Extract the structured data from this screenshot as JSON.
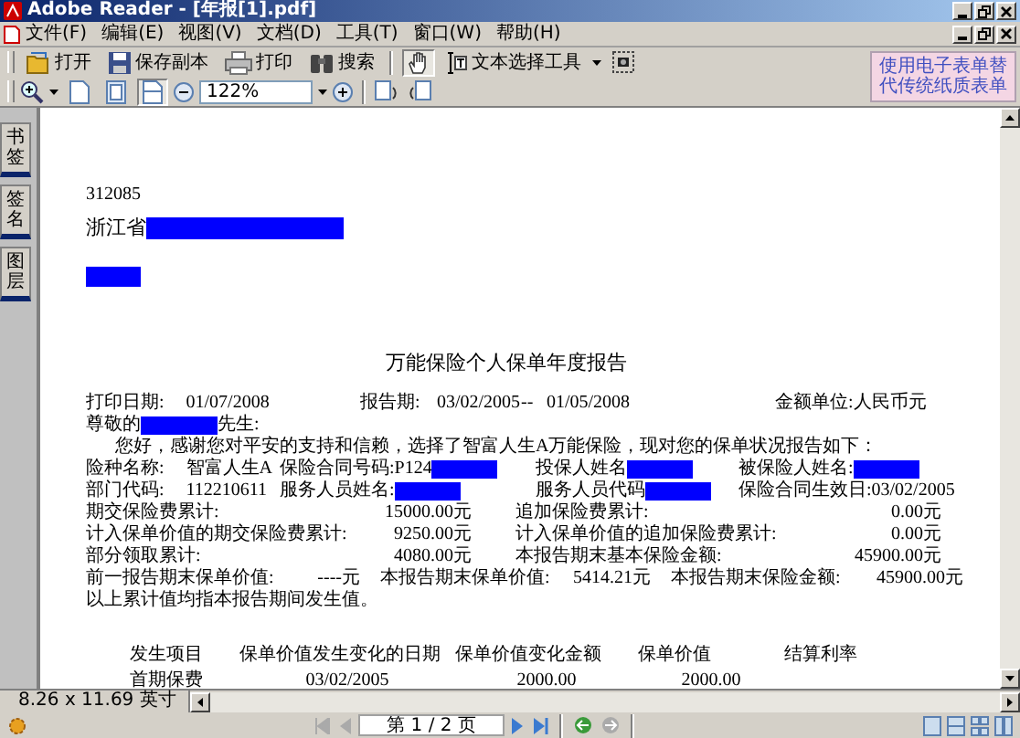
{
  "window": {
    "title": "Adobe Reader - [年报[1].pdf]"
  },
  "menu": [
    {
      "label": "文件(F)"
    },
    {
      "label": "编辑(E)"
    },
    {
      "label": "视图(V)"
    },
    {
      "label": "文档(D)"
    },
    {
      "label": "工具(T)"
    },
    {
      "label": "窗口(W)"
    },
    {
      "label": "帮助(H)"
    }
  ],
  "toolbar_file": [
    {
      "label": "打开"
    },
    {
      "label": "保存副本"
    },
    {
      "label": "打印"
    },
    {
      "label": "搜索"
    }
  ],
  "tools": [
    {
      "kind": "hand",
      "selected": true
    },
    {
      "kind": "text_select",
      "label": "文本选择工具",
      "selected": false
    },
    {
      "kind": "snapshot",
      "selected": false
    }
  ],
  "view_buttons": [
    {
      "selected": false
    },
    {
      "selected": false
    },
    {
      "selected": true
    }
  ],
  "zoom": {
    "value": "122%"
  },
  "ad_banner": {
    "lines": [
      "使用电子表单替",
      "代传统纸质表单"
    ]
  },
  "nav_tabs": [
    {
      "label": "书签"
    },
    {
      "label": "签名"
    },
    {
      "label": "图层"
    }
  ],
  "document": {
    "lines": [
      {
        "kind": "postcode",
        "segments": [
          {
            "kind": "text",
            "text": "312085"
          }
        ]
      },
      {
        "kind": "address",
        "segments": [
          {
            "kind": "text",
            "text": "浙江省"
          },
          {
            "kind": "redaction"
          }
        ]
      },
      {
        "kind": "recipient",
        "segments": [
          {
            "kind": "redaction"
          }
        ]
      },
      {
        "kind": "title",
        "segments": [
          {
            "kind": "text",
            "text": "万能保险个人保单年度报告"
          }
        ]
      },
      {
        "kind": "header",
        "cells": [
          [
            {
              "kind": "text",
              "text": "打印日期:"
            },
            {
              "kind": "text",
              "text": "01/07/2008"
            }
          ],
          [
            {
              "kind": "text",
              "text": "报告期:"
            }
          ],
          [
            {
              "kind": "text",
              "text": "03/02/2005"
            }
          ],
          [
            {
              "kind": "text",
              "text": "--"
            }
          ],
          [
            {
              "kind": "text",
              "text": "01/05/2008"
            }
          ],
          [
            {
              "kind": "text",
              "text": "金额单位:人民币元"
            }
          ]
        ]
      },
      {
        "kind": "greeting",
        "segments": [
          {
            "kind": "text",
            "text": "尊敬的"
          },
          {
            "kind": "redaction"
          },
          {
            "kind": "text",
            "text": "先生:"
          }
        ]
      },
      {
        "kind": "intro",
        "segments": [
          {
            "kind": "text",
            "text": "您好，感谢您对平安的支持和信赖，选择了智富人生A万能保险，现对您的保单状况报告如下："
          }
        ]
      },
      {
        "kind": "info",
        "cells": [
          [
            {
              "kind": "text",
              "text": "险种名称:"
            },
            {
              "kind": "text",
              "text": "智富人生A"
            }
          ],
          [
            {
              "kind": "text",
              "text": "保险合同号码:P124"
            },
            {
              "kind": "redaction"
            }
          ],
          [
            {
              "kind": "text",
              "text": "投保人姓名"
            },
            {
              "kind": "redaction"
            }
          ],
          [
            {
              "kind": "text",
              "text": "被保险人姓名:"
            },
            {
              "kind": "redaction"
            }
          ]
        ]
      },
      {
        "kind": "info",
        "cells": [
          [
            {
              "kind": "text",
              "text": "部门代码:"
            },
            {
              "kind": "text",
              "text": "112210611"
            }
          ],
          [
            {
              "kind": "text",
              "text": "服务人员姓名:"
            },
            {
              "kind": "redaction"
            }
          ],
          [
            {
              "kind": "text",
              "text": "服务人员代码"
            },
            {
              "kind": "redaction"
            }
          ],
          [
            {
              "kind": "text",
              "text": "保险合同生效日:03/02/2005"
            }
          ]
        ]
      },
      {
        "kind": "amount",
        "pairs": [
          {
            "label": "期交保险费累计:",
            "value": "15000.00元"
          },
          {
            "label": "追加保险费累计:",
            "value": "0.00元"
          }
        ]
      },
      {
        "kind": "amount",
        "pairs": [
          {
            "label": "计入保单价值的期交保险费累计:",
            "value": "9250.00元"
          },
          {
            "label": "计入保单价值的追加保险费累计:",
            "value": "0.00元"
          }
        ]
      },
      {
        "kind": "amount",
        "pairs": [
          {
            "label": "部分领取累计:",
            "value": "4080.00元"
          },
          {
            "label": "本报告期末基本保险金额:",
            "value": "45900.00元"
          }
        ]
      },
      {
        "kind": "summary",
        "pairs": [
          {
            "label": "前一报告期末保单价值:",
            "value": "----元"
          },
          {
            "label": "本报告期末保单价值:",
            "value": "5414.21元"
          },
          {
            "label": "本报告期末保险金额:",
            "value": "45900.00元"
          }
        ]
      },
      {
        "kind": "note",
        "segments": [
          {
            "kind": "text",
            "text": "以上累计值均指本报告期间发生值。"
          }
        ]
      }
    ],
    "history": {
      "columns": [
        "发生项目",
        "保单价值发生变化的日期",
        "保单价值变化金额",
        "保单价值",
        "结算利率"
      ],
      "rows": [
        [
          "首期保费",
          "03/02/2005",
          "2000.00",
          "2000.00"
        ]
      ]
    }
  },
  "status_bar": {
    "page_size": "8.26 x 11.69 英寸",
    "page_field": "第 1 / 2 页"
  }
}
